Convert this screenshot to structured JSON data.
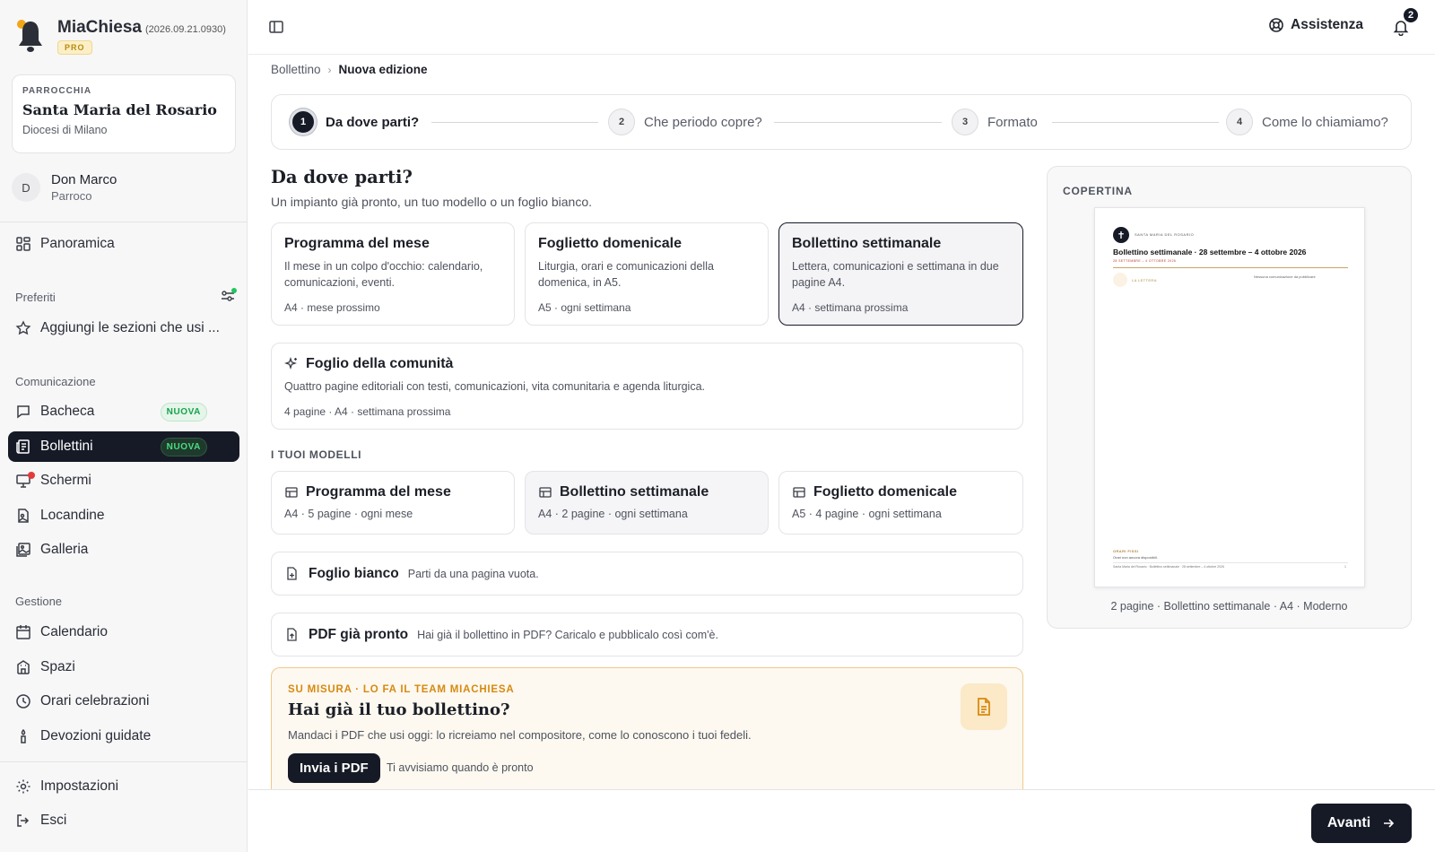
{
  "app": {
    "name": "MiaChiesa",
    "version": "(2026.09.21.0930)",
    "plan": "PRO"
  },
  "parish": {
    "kicker": "PARROCCHIA",
    "name": "Santa Maria del Rosario",
    "diocese": "Diocesi di Milano"
  },
  "user": {
    "initial": "D",
    "name": "Don Marco",
    "role": "Parroco"
  },
  "nav": {
    "overview": "Panoramica",
    "favorites_title": "Preferiti",
    "favorites_add": "Aggiungi le sezioni che usi ...",
    "communication_title": "Comunicazione",
    "board": "Bacheca",
    "board_badge": "NUOVA",
    "bulletins": "Bollettini",
    "bulletins_badge": "NUOVA",
    "screens": "Schermi",
    "posters": "Locandine",
    "gallery": "Galleria",
    "management_title": "Gestione",
    "calendar": "Calendario",
    "spaces": "Spazi",
    "celebrations": "Orari celebrazioni",
    "devotions": "Devozioni guidate",
    "settings": "Impostazioni",
    "logout": "Esci"
  },
  "topbar": {
    "help": "Assistenza",
    "notifications": "2"
  },
  "breadcrumb": {
    "parent": "Bollettino",
    "current": "Nuova edizione"
  },
  "steps": [
    {
      "num": "1",
      "label": "Da dove parti?"
    },
    {
      "num": "2",
      "label": "Che periodo copre?"
    },
    {
      "num": "3",
      "label": "Formato"
    },
    {
      "num": "4",
      "label": "Come lo chiamiamo?"
    }
  ],
  "section": {
    "title": "Da dove parti?",
    "subtitle": "Un impianto già pronto, un tuo modello o un foglio bianco."
  },
  "presets": [
    {
      "title": "Programma del mese",
      "desc": "Il mese in un colpo d'occhio: calendario, comunicazioni, eventi.",
      "meta": "A4 · mese prossimo"
    },
    {
      "title": "Foglietto domenicale",
      "desc": "Liturgia, orari e comunicazioni della domenica, in A5.",
      "meta": "A5 · ogni settimana"
    },
    {
      "title": "Bollettino settimanale",
      "desc": "Lettera, comunicazioni e settimana in due pagine A4.",
      "meta": "A4 · settimana prossima"
    }
  ],
  "community": {
    "title": "Foglio della comunità",
    "desc": "Quattro pagine editoriali con testi, comunicazioni, vita comunitaria e agenda liturgica.",
    "meta": "4 pagine · A4 · settimana prossima"
  },
  "my_templates": {
    "label": "I TUOI MODELLI",
    "items": [
      {
        "title": "Programma del mese",
        "meta": "A4 · 5 pagine · ogni mese"
      },
      {
        "title": "Bollettino settimanale",
        "meta": "A4 · 2 pagine · ogni settimana"
      },
      {
        "title": "Foglietto domenicale",
        "meta": "A5 · 4 pagine · ogni settimana"
      }
    ]
  },
  "blank": {
    "title": "Foglio bianco",
    "desc": "Parti da una pagina vuota."
  },
  "pdf": {
    "title": "PDF già pronto",
    "desc": "Hai già il bollettino in PDF? Caricalo e pubblicalo così com'è."
  },
  "promo": {
    "kicker": "SU MISURA · LO FA IL TEAM MIACHIESA",
    "title": "Hai già il tuo bollettino?",
    "desc": "Mandaci i PDF che usi oggi: lo ricreiamo nel compositore, come lo conoscono i tuoi fedeli.",
    "button": "Invia i PDF",
    "note": "Ti avvisiamo quando è pronto"
  },
  "preview": {
    "label": "COPERTINA",
    "doc_parish": "SANTA MARIA DEL ROSARIO",
    "doc_title": "Bollettino settimanale · 28 settembre – 4 ottobre 2026",
    "doc_dates": "28 SETTEMBRE – 4 OTTOBRE 2026",
    "doc_letter": "LA LETTERA",
    "doc_empty": "Nessuna comunicazione da pubblicare",
    "doc_hours": "ORARI FISSI",
    "doc_hours_note": "Orari non ancora disponibili.",
    "doc_footer": "Santa Maria del Rosario · Bollettino settimanale · 28 settembre – 4 ottobre 2026",
    "doc_page": "1",
    "caption": "2 pagine · Bollettino settimanale · A4 · Moderno"
  },
  "footer": {
    "next": "Avanti"
  }
}
